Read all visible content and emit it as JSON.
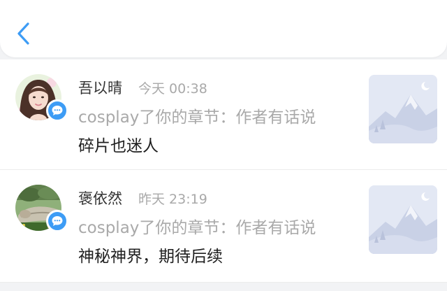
{
  "colors": {
    "accent": "#3d9cf5",
    "name_text": "#333333",
    "secondary_text": "#a9a9a9",
    "comment_text": "#1f1f1f",
    "background": "#f2f3f5"
  },
  "header": {
    "back_icon": "chevron-left-icon"
  },
  "notifications": [
    {
      "name": "吾以晴",
      "time": "今天 00:38",
      "action": "cosplay了你的章节：作者有话说",
      "comment": "碎片也迷人",
      "badge_icon": "comment-bubble-icon",
      "thumbnail_icon": "mountain-placeholder-icon"
    },
    {
      "name": "褒依然",
      "time": "昨天 23:19",
      "action": "cosplay了你的章节：作者有话说",
      "comment": "神秘神界，期待后续",
      "badge_icon": "comment-bubble-icon",
      "thumbnail_icon": "mountain-placeholder-icon"
    }
  ]
}
